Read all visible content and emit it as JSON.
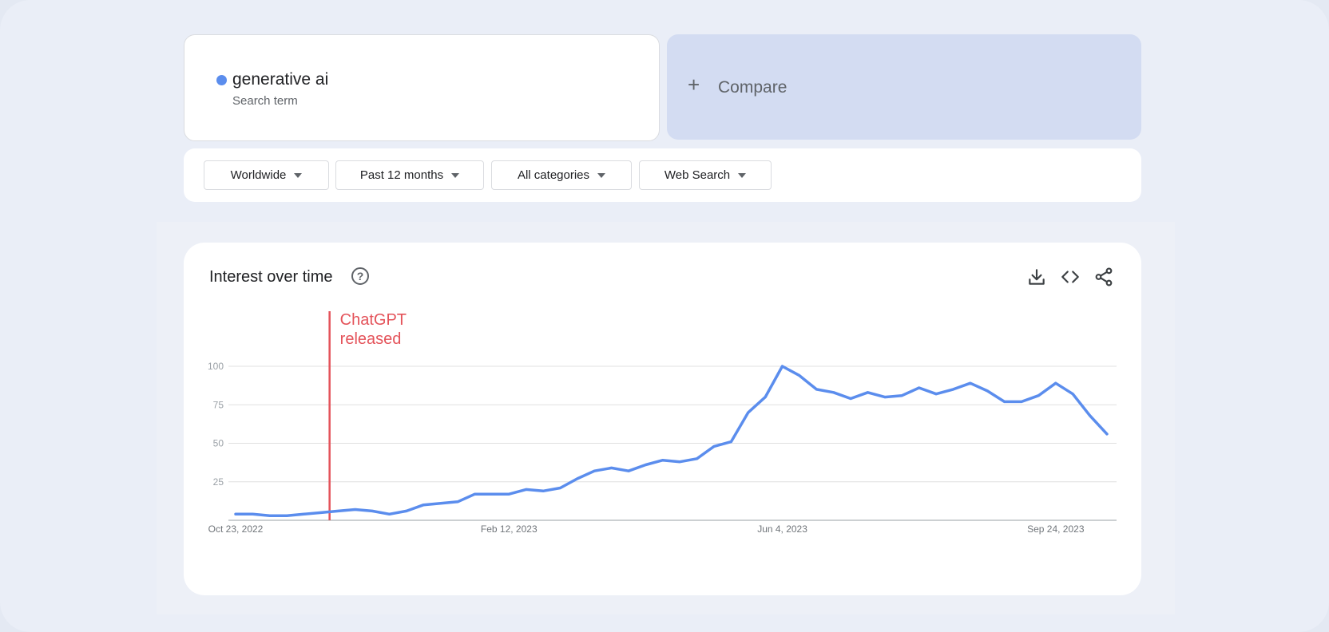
{
  "search_term": {
    "name": "generative ai",
    "type": "Search term",
    "color": "#5b8ded"
  },
  "compare": {
    "icon": "plus-icon",
    "label": "Compare"
  },
  "filters": {
    "region": "Worldwide",
    "period": "Past 12 months",
    "category": "All categories",
    "search_type": "Web Search"
  },
  "interest_panel": {
    "title": "Interest over time",
    "icons": [
      "help-icon",
      "download-icon",
      "embed-code-icon",
      "share-icon"
    ]
  },
  "annotation": {
    "text_line1": "ChatGPT",
    "text_line2": "released",
    "color": "#e4535a",
    "x": 5.5
  },
  "chart_data": {
    "type": "line",
    "title": "",
    "xlabel": "",
    "ylabel": "",
    "ylim": [
      0,
      100
    ],
    "yticks": [
      25,
      50,
      75,
      100
    ],
    "x_tick_labels": [
      {
        "label": "Oct 23, 2022",
        "x": 0
      },
      {
        "label": "Feb 12, 2023",
        "x": 16
      },
      {
        "label": "Jun 4, 2023",
        "x": 32
      },
      {
        "label": "Sep 24, 2023",
        "x": 48
      }
    ],
    "grid": true,
    "series": [
      {
        "name": "generative ai",
        "color": "#5b8ded",
        "values": [
          4,
          4,
          3,
          3,
          4,
          5,
          6,
          7,
          6,
          4,
          6,
          10,
          11,
          12,
          17,
          17,
          17,
          20,
          19,
          21,
          27,
          32,
          34,
          32,
          36,
          39,
          38,
          40,
          48,
          51,
          70,
          80,
          100,
          94,
          85,
          83,
          79,
          83,
          80,
          81,
          86,
          82,
          85,
          89,
          84,
          77,
          77,
          81,
          89,
          82,
          68,
          56
        ]
      }
    ]
  }
}
